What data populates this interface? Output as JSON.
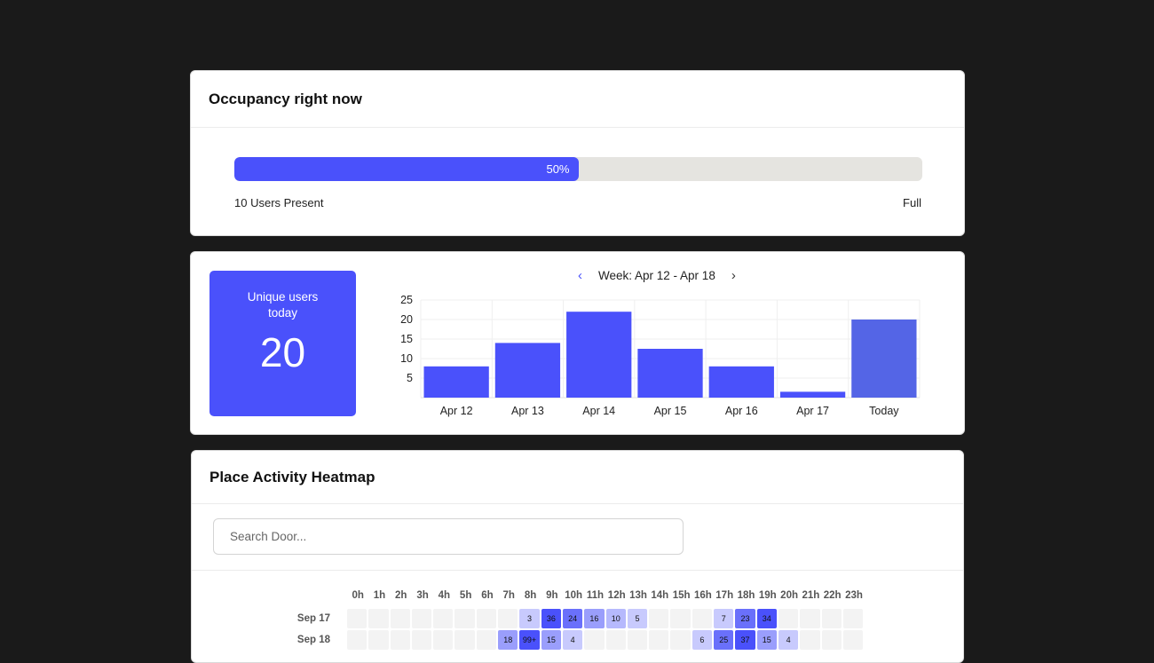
{
  "occupancy": {
    "title": "Occupancy right now",
    "percent_label": "50%",
    "percent": 50,
    "users_present": "10 Users Present",
    "full_label": "Full"
  },
  "stats": {
    "unique_label": "Unique users today",
    "unique_value": "20",
    "week_label": "Week: Apr 12 - Apr 18"
  },
  "chart_data": {
    "type": "bar",
    "categories": [
      "Apr 12",
      "Apr 13",
      "Apr 14",
      "Apr 15",
      "Apr 16",
      "Apr 17",
      "Today"
    ],
    "values": [
      8,
      14,
      22,
      12.5,
      8,
      1.5,
      20
    ],
    "yticks": [
      5,
      10,
      15,
      20,
      25
    ],
    "ylim": [
      0,
      25
    ],
    "title": "",
    "xlabel": "",
    "ylabel": "",
    "grid": true
  },
  "heatmap": {
    "title": "Place Activity Heatmap",
    "search_placeholder": "Search Door...",
    "hours": [
      "0h",
      "1h",
      "2h",
      "3h",
      "4h",
      "5h",
      "6h",
      "7h",
      "8h",
      "9h",
      "10h",
      "11h",
      "12h",
      "13h",
      "14h",
      "15h",
      "16h",
      "17h",
      "18h",
      "19h",
      "20h",
      "21h",
      "22h",
      "23h"
    ],
    "rows": [
      {
        "label": "Sep 17",
        "cells": [
          "",
          "",
          "",
          "",
          "",
          "",
          "",
          "",
          "3",
          "36",
          "24",
          "16",
          "10",
          "5",
          "",
          "",
          "",
          "7",
          "23",
          "34",
          "",
          "",
          "",
          ""
        ]
      },
      {
        "label": "Sep 18",
        "cells": [
          "",
          "",
          "",
          "",
          "",
          "",
          "",
          "18",
          "99+",
          "15",
          "4",
          "",
          "",
          "",
          "",
          "",
          "6",
          "25",
          "37",
          "15",
          "4",
          "",
          "",
          ""
        ]
      }
    ]
  },
  "colors": {
    "accent": "#4a51fb",
    "today_bar": "#5465e6",
    "background": "#1a1a1a"
  }
}
